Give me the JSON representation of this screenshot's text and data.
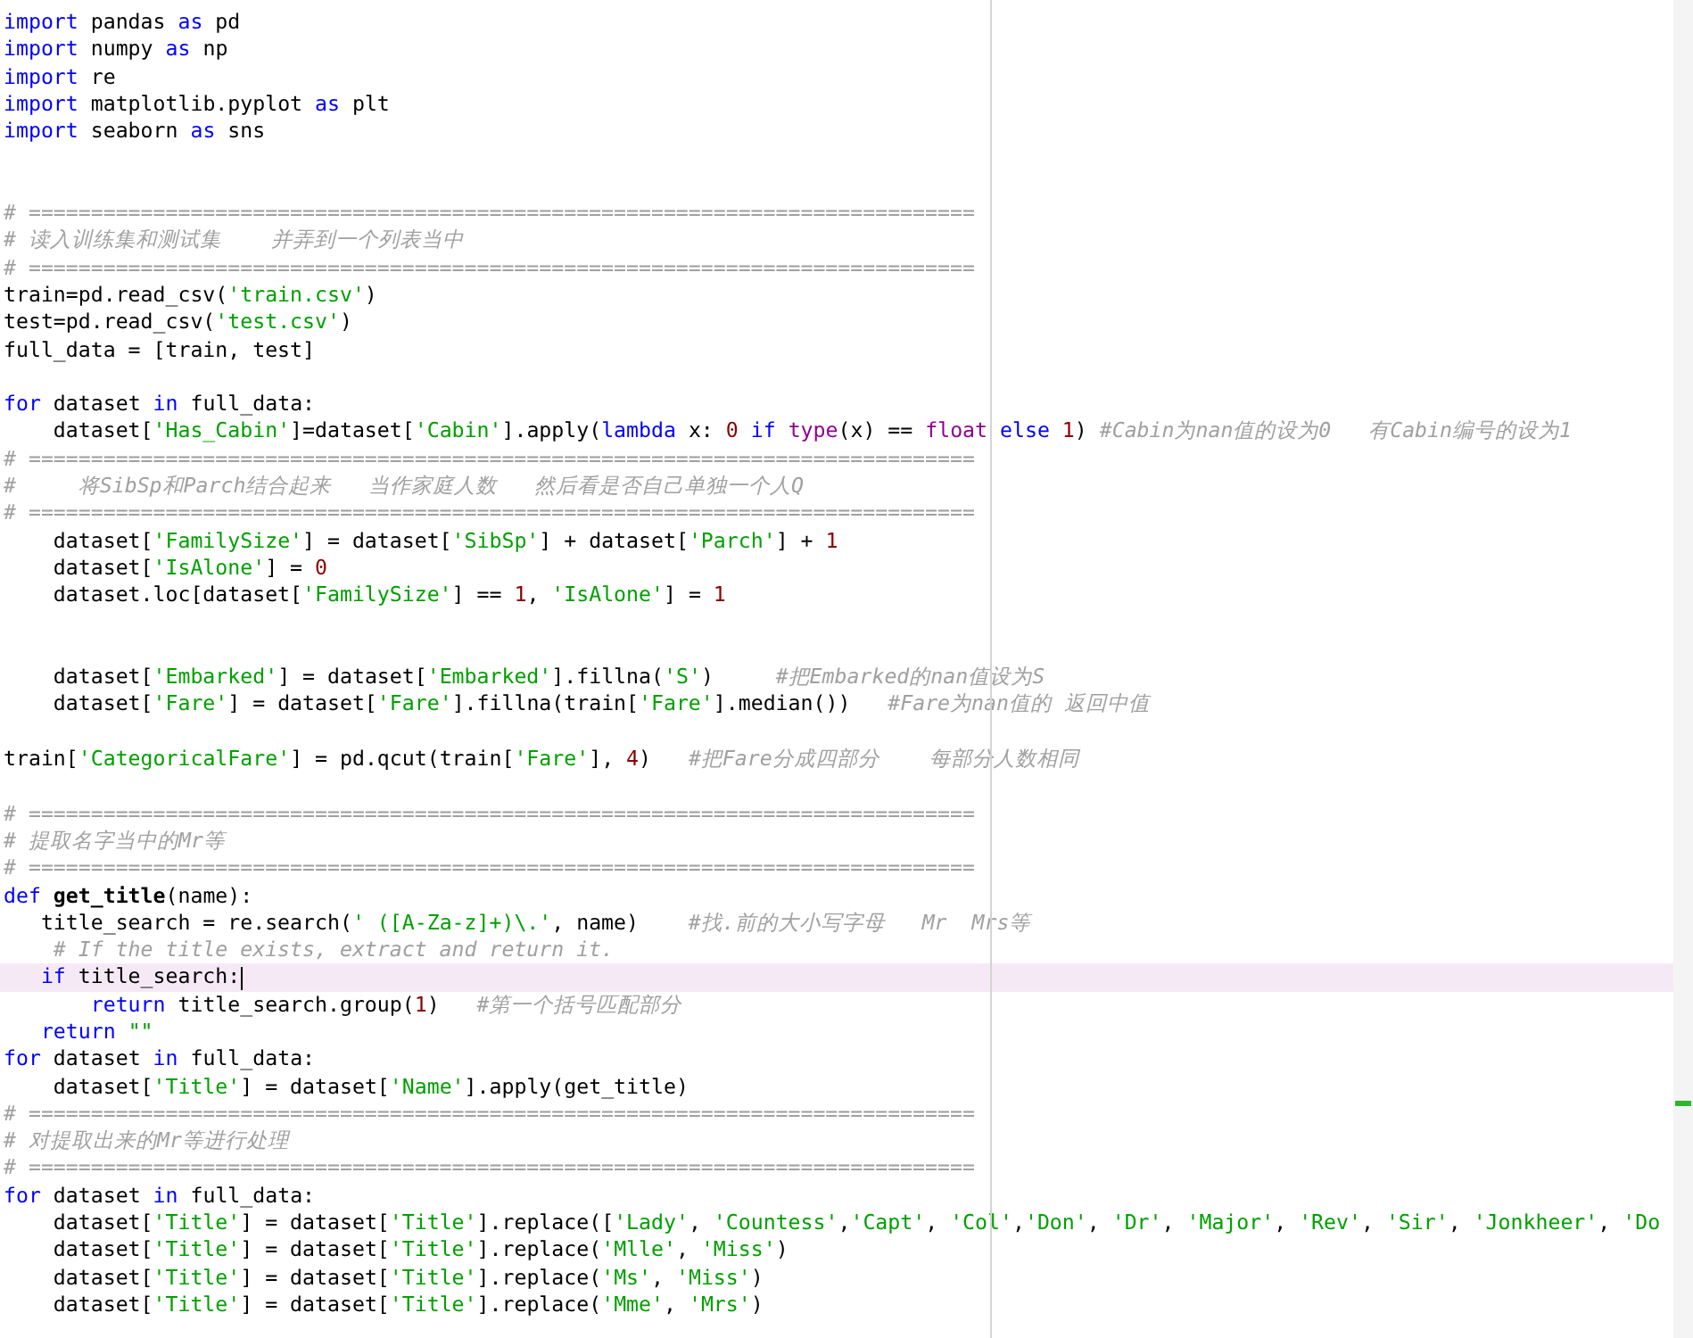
{
  "editor": {
    "lines": [
      {
        "kind": "code",
        "current": false,
        "tokens": [
          {
            "kind": "keyword",
            "text": "import"
          },
          {
            "kind": "plain",
            "text": " pandas "
          },
          {
            "kind": "keyword",
            "text": "as"
          },
          {
            "kind": "plain",
            "text": " pd"
          }
        ]
      },
      {
        "kind": "code",
        "current": false,
        "tokens": [
          {
            "kind": "keyword",
            "text": "import"
          },
          {
            "kind": "plain",
            "text": " numpy "
          },
          {
            "kind": "keyword",
            "text": "as"
          },
          {
            "kind": "plain",
            "text": " np"
          }
        ]
      },
      {
        "kind": "code",
        "current": false,
        "tokens": [
          {
            "kind": "keyword",
            "text": "import"
          },
          {
            "kind": "plain",
            "text": " re"
          }
        ]
      },
      {
        "kind": "code",
        "current": false,
        "tokens": [
          {
            "kind": "keyword",
            "text": "import"
          },
          {
            "kind": "plain",
            "text": " matplotlib.pyplot "
          },
          {
            "kind": "keyword",
            "text": "as"
          },
          {
            "kind": "plain",
            "text": " plt"
          }
        ]
      },
      {
        "kind": "code",
        "current": false,
        "tokens": [
          {
            "kind": "keyword",
            "text": "import"
          },
          {
            "kind": "plain",
            "text": " seaborn "
          },
          {
            "kind": "keyword",
            "text": "as"
          },
          {
            "kind": "plain",
            "text": " sns"
          }
        ]
      },
      {
        "kind": "blank",
        "current": false
      },
      {
        "kind": "blank",
        "current": false
      },
      {
        "kind": "code",
        "current": false,
        "tokens": [
          {
            "kind": "comment",
            "text": "# ============================================================================"
          }
        ]
      },
      {
        "kind": "code",
        "current": false,
        "tokens": [
          {
            "kind": "comment",
            "text": "# 读入训练集和测试集    并弄到一个列表当中"
          }
        ]
      },
      {
        "kind": "code",
        "current": false,
        "tokens": [
          {
            "kind": "comment",
            "text": "# ============================================================================"
          }
        ]
      },
      {
        "kind": "code",
        "current": false,
        "tokens": [
          {
            "kind": "plain",
            "text": "train=pd.read_csv("
          },
          {
            "kind": "string",
            "text": "'train.csv'"
          },
          {
            "kind": "plain",
            "text": ")"
          }
        ]
      },
      {
        "kind": "code",
        "current": false,
        "tokens": [
          {
            "kind": "plain",
            "text": "test=pd.read_csv("
          },
          {
            "kind": "string",
            "text": "'test.csv'"
          },
          {
            "kind": "plain",
            "text": ")"
          }
        ]
      },
      {
        "kind": "code",
        "current": false,
        "tokens": [
          {
            "kind": "plain",
            "text": "full_data = [train, test]"
          }
        ]
      },
      {
        "kind": "blank",
        "current": false
      },
      {
        "kind": "code",
        "current": false,
        "tokens": [
          {
            "kind": "keyword",
            "text": "for"
          },
          {
            "kind": "plain",
            "text": " dataset "
          },
          {
            "kind": "keyword",
            "text": "in"
          },
          {
            "kind": "plain",
            "text": " full_data:"
          }
        ]
      },
      {
        "kind": "code",
        "current": false,
        "tokens": [
          {
            "kind": "plain",
            "text": "    dataset["
          },
          {
            "kind": "string",
            "text": "'Has_Cabin'"
          },
          {
            "kind": "plain",
            "text": "]=dataset["
          },
          {
            "kind": "string",
            "text": "'Cabin'"
          },
          {
            "kind": "plain",
            "text": "].apply("
          },
          {
            "kind": "keyword",
            "text": "lambda"
          },
          {
            "kind": "plain",
            "text": " x: "
          },
          {
            "kind": "number",
            "text": "0 "
          },
          {
            "kind": "keyword",
            "text": "if "
          },
          {
            "kind": "builtin",
            "text": "type"
          },
          {
            "kind": "plain",
            "text": "(x) == "
          },
          {
            "kind": "builtin",
            "text": "float "
          },
          {
            "kind": "keyword",
            "text": "else "
          },
          {
            "kind": "number",
            "text": "1"
          },
          {
            "kind": "plain",
            "text": ") "
          },
          {
            "kind": "comment",
            "text": "#Cabin为nan值的设为0   有Cabin编号的设为1"
          }
        ]
      },
      {
        "kind": "code",
        "current": false,
        "tokens": [
          {
            "kind": "comment",
            "text": "# ============================================================================"
          }
        ]
      },
      {
        "kind": "code",
        "current": false,
        "tokens": [
          {
            "kind": "comment",
            "text": "#     将SibSp和Parch结合起来   当作家庭人数   然后看是否自己单独一个人Q"
          }
        ]
      },
      {
        "kind": "code",
        "current": false,
        "tokens": [
          {
            "kind": "comment",
            "text": "# ============================================================================"
          }
        ]
      },
      {
        "kind": "code",
        "current": false,
        "tokens": [
          {
            "kind": "plain",
            "text": "    dataset["
          },
          {
            "kind": "string",
            "text": "'FamilySize'"
          },
          {
            "kind": "plain",
            "text": "] = dataset["
          },
          {
            "kind": "string",
            "text": "'SibSp'"
          },
          {
            "kind": "plain",
            "text": "] + dataset["
          },
          {
            "kind": "string",
            "text": "'Parch'"
          },
          {
            "kind": "plain",
            "text": "] + "
          },
          {
            "kind": "number",
            "text": "1"
          }
        ]
      },
      {
        "kind": "code",
        "current": false,
        "tokens": [
          {
            "kind": "plain",
            "text": "    dataset["
          },
          {
            "kind": "string",
            "text": "'IsAlone'"
          },
          {
            "kind": "plain",
            "text": "] = "
          },
          {
            "kind": "number",
            "text": "0"
          }
        ]
      },
      {
        "kind": "code",
        "current": false,
        "tokens": [
          {
            "kind": "plain",
            "text": "    dataset.loc[dataset["
          },
          {
            "kind": "string",
            "text": "'FamilySize'"
          },
          {
            "kind": "plain",
            "text": "] == "
          },
          {
            "kind": "number",
            "text": "1"
          },
          {
            "kind": "plain",
            "text": ", "
          },
          {
            "kind": "string",
            "text": "'IsAlone'"
          },
          {
            "kind": "plain",
            "text": "] = "
          },
          {
            "kind": "number",
            "text": "1"
          }
        ]
      },
      {
        "kind": "blank",
        "current": false
      },
      {
        "kind": "blank",
        "current": false
      },
      {
        "kind": "code",
        "current": false,
        "tokens": [
          {
            "kind": "plain",
            "text": "    dataset["
          },
          {
            "kind": "string",
            "text": "'Embarked'"
          },
          {
            "kind": "plain",
            "text": "] = dataset["
          },
          {
            "kind": "string",
            "text": "'Embarked'"
          },
          {
            "kind": "plain",
            "text": "].fillna("
          },
          {
            "kind": "string",
            "text": "'S'"
          },
          {
            "kind": "plain",
            "text": ")     "
          },
          {
            "kind": "comment",
            "text": "#把Embarked的nan值设为S"
          }
        ]
      },
      {
        "kind": "code",
        "current": false,
        "tokens": [
          {
            "kind": "plain",
            "text": "    dataset["
          },
          {
            "kind": "string",
            "text": "'Fare'"
          },
          {
            "kind": "plain",
            "text": "] = dataset["
          },
          {
            "kind": "string",
            "text": "'Fare'"
          },
          {
            "kind": "plain",
            "text": "].fillna(train["
          },
          {
            "kind": "string",
            "text": "'Fare'"
          },
          {
            "kind": "plain",
            "text": "].median())   "
          },
          {
            "kind": "comment",
            "text": "#Fare为nan值的 返回中值"
          }
        ]
      },
      {
        "kind": "blank",
        "current": false
      },
      {
        "kind": "code",
        "current": false,
        "tokens": [
          {
            "kind": "plain",
            "text": "train["
          },
          {
            "kind": "string",
            "text": "'CategoricalFare'"
          },
          {
            "kind": "plain",
            "text": "] = pd.qcut(train["
          },
          {
            "kind": "string",
            "text": "'Fare'"
          },
          {
            "kind": "plain",
            "text": "], "
          },
          {
            "kind": "number",
            "text": "4"
          },
          {
            "kind": "plain",
            "text": ")   "
          },
          {
            "kind": "comment",
            "text": "#把Fare分成四部分    每部分人数相同"
          }
        ]
      },
      {
        "kind": "blank",
        "current": false
      },
      {
        "kind": "code",
        "current": false,
        "tokens": [
          {
            "kind": "comment",
            "text": "# ============================================================================"
          }
        ]
      },
      {
        "kind": "code",
        "current": false,
        "tokens": [
          {
            "kind": "comment",
            "text": "# 提取名字当中的Mr等"
          }
        ]
      },
      {
        "kind": "code",
        "current": false,
        "tokens": [
          {
            "kind": "comment",
            "text": "# ============================================================================"
          }
        ]
      },
      {
        "kind": "code",
        "current": false,
        "tokens": [
          {
            "kind": "keyword",
            "text": "def "
          },
          {
            "kind": "function",
            "text": "get_title"
          },
          {
            "kind": "plain",
            "text": "(name):"
          }
        ]
      },
      {
        "kind": "code",
        "current": false,
        "tokens": [
          {
            "kind": "plain",
            "text": "   title_search = re.search("
          },
          {
            "kind": "string",
            "text": "' ([A-Za-z]+)\\.'"
          },
          {
            "kind": "plain",
            "text": ", name)    "
          },
          {
            "kind": "comment",
            "text": "#找.前的大小写字母   Mr  Mrs等"
          }
        ]
      },
      {
        "kind": "code",
        "current": false,
        "tokens": [
          {
            "kind": "comment",
            "text": "    # If the title exists, extract and return it."
          }
        ]
      },
      {
        "kind": "code",
        "current": true,
        "tokens": [
          {
            "kind": "keyword",
            "text": "   if"
          },
          {
            "kind": "plain",
            "text": " title_search:"
          }
        ]
      },
      {
        "kind": "code",
        "current": false,
        "tokens": [
          {
            "kind": "keyword",
            "text": "       return"
          },
          {
            "kind": "plain",
            "text": " title_search.group("
          },
          {
            "kind": "number",
            "text": "1"
          },
          {
            "kind": "plain",
            "text": ")   "
          },
          {
            "kind": "comment",
            "text": "#第一个括号匹配部分"
          }
        ]
      },
      {
        "kind": "code",
        "current": false,
        "tokens": [
          {
            "kind": "keyword",
            "text": "   return "
          },
          {
            "kind": "string",
            "text": "\"\""
          }
        ]
      },
      {
        "kind": "code",
        "current": false,
        "tokens": [
          {
            "kind": "keyword",
            "text": "for"
          },
          {
            "kind": "plain",
            "text": " dataset "
          },
          {
            "kind": "keyword",
            "text": "in"
          },
          {
            "kind": "plain",
            "text": " full_data:"
          }
        ]
      },
      {
        "kind": "code",
        "current": false,
        "tokens": [
          {
            "kind": "plain",
            "text": "    dataset["
          },
          {
            "kind": "string",
            "text": "'Title'"
          },
          {
            "kind": "plain",
            "text": "] = dataset["
          },
          {
            "kind": "string",
            "text": "'Name'"
          },
          {
            "kind": "plain",
            "text": "].apply(get_title)"
          }
        ]
      },
      {
        "kind": "code",
        "current": false,
        "tokens": [
          {
            "kind": "comment",
            "text": "# ============================================================================"
          }
        ]
      },
      {
        "kind": "code",
        "current": false,
        "tokens": [
          {
            "kind": "comment",
            "text": "# 对提取出来的Mr等进行处理"
          }
        ]
      },
      {
        "kind": "code",
        "current": false,
        "tokens": [
          {
            "kind": "comment",
            "text": "# ============================================================================"
          }
        ]
      },
      {
        "kind": "code",
        "current": false,
        "tokens": [
          {
            "kind": "keyword",
            "text": "for"
          },
          {
            "kind": "plain",
            "text": " dataset "
          },
          {
            "kind": "keyword",
            "text": "in"
          },
          {
            "kind": "plain",
            "text": " full_data:"
          }
        ]
      },
      {
        "kind": "code",
        "current": false,
        "tokens": [
          {
            "kind": "plain",
            "text": "    dataset["
          },
          {
            "kind": "string",
            "text": "'Title'"
          },
          {
            "kind": "plain",
            "text": "] = dataset["
          },
          {
            "kind": "string",
            "text": "'Title'"
          },
          {
            "kind": "plain",
            "text": "].replace(["
          },
          {
            "kind": "string",
            "text": "'Lady'"
          },
          {
            "kind": "plain",
            "text": ", "
          },
          {
            "kind": "string",
            "text": "'Countess'"
          },
          {
            "kind": "plain",
            "text": ","
          },
          {
            "kind": "string",
            "text": "'Capt'"
          },
          {
            "kind": "plain",
            "text": ", "
          },
          {
            "kind": "string",
            "text": "'Col'"
          },
          {
            "kind": "plain",
            "text": ","
          },
          {
            "kind": "string",
            "text": "'Don'"
          },
          {
            "kind": "plain",
            "text": ", "
          },
          {
            "kind": "string",
            "text": "'Dr'"
          },
          {
            "kind": "plain",
            "text": ", "
          },
          {
            "kind": "string",
            "text": "'Major'"
          },
          {
            "kind": "plain",
            "text": ", "
          },
          {
            "kind": "string",
            "text": "'Rev'"
          },
          {
            "kind": "plain",
            "text": ", "
          },
          {
            "kind": "string",
            "text": "'Sir'"
          },
          {
            "kind": "plain",
            "text": ", "
          },
          {
            "kind": "string",
            "text": "'Jonkheer'"
          },
          {
            "kind": "plain",
            "text": ", "
          },
          {
            "kind": "string",
            "text": "'Do"
          }
        ]
      },
      {
        "kind": "code",
        "current": false,
        "tokens": [
          {
            "kind": "plain",
            "text": "    dataset["
          },
          {
            "kind": "string",
            "text": "'Title'"
          },
          {
            "kind": "plain",
            "text": "] = dataset["
          },
          {
            "kind": "string",
            "text": "'Title'"
          },
          {
            "kind": "plain",
            "text": "].replace("
          },
          {
            "kind": "string",
            "text": "'Mlle'"
          },
          {
            "kind": "plain",
            "text": ", "
          },
          {
            "kind": "string",
            "text": "'Miss'"
          },
          {
            "kind": "plain",
            "text": ")"
          }
        ]
      },
      {
        "kind": "code",
        "current": false,
        "tokens": [
          {
            "kind": "plain",
            "text": "    dataset["
          },
          {
            "kind": "string",
            "text": "'Title'"
          },
          {
            "kind": "plain",
            "text": "] = dataset["
          },
          {
            "kind": "string",
            "text": "'Title'"
          },
          {
            "kind": "plain",
            "text": "].replace("
          },
          {
            "kind": "string",
            "text": "'Ms'"
          },
          {
            "kind": "plain",
            "text": ", "
          },
          {
            "kind": "string",
            "text": "'Miss'"
          },
          {
            "kind": "plain",
            "text": ")"
          }
        ]
      },
      {
        "kind": "code",
        "current": false,
        "tokens": [
          {
            "kind": "plain",
            "text": "    dataset["
          },
          {
            "kind": "string",
            "text": "'Title'"
          },
          {
            "kind": "plain",
            "text": "] = dataset["
          },
          {
            "kind": "string",
            "text": "'Title'"
          },
          {
            "kind": "plain",
            "text": "].replace("
          },
          {
            "kind": "string",
            "text": "'Mme'"
          },
          {
            "kind": "plain",
            "text": ", "
          },
          {
            "kind": "string",
            "text": "'Mrs'"
          },
          {
            "kind": "plain",
            "text": ")"
          }
        ]
      }
    ]
  }
}
